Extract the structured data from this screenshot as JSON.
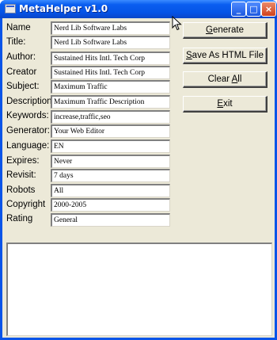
{
  "window": {
    "title": "MetaHelper v1.0"
  },
  "fields": [
    {
      "label": "Name",
      "value": "Nerd Lib Software Labs"
    },
    {
      "label": "Title:",
      "value": "Nerd Lib Software Labs"
    },
    {
      "label": "Author:",
      "value": "Sustained Hits Intl. Tech Corp"
    },
    {
      "label": "Creator",
      "value": "Sustained Hits Intl. Tech Corp"
    },
    {
      "label": "Subject:",
      "value": "Maximum Traffic"
    },
    {
      "label": "Description:",
      "value": "Maximum Traffic Description"
    },
    {
      "label": "Keywords:",
      "value": "increase,traffic,seo"
    },
    {
      "label": "Generator:",
      "value": "Your Web Editor"
    },
    {
      "label": "Language:",
      "value": "EN"
    },
    {
      "label": "Expires:",
      "value": "Never"
    },
    {
      "label": "Revisit:",
      "value": "7 days"
    },
    {
      "label": "Robots",
      "value": "All"
    },
    {
      "label": "Copyright",
      "value": "2000-2005"
    },
    {
      "label": "Rating",
      "value": "General"
    }
  ],
  "buttons": {
    "generate": {
      "pre": "",
      "key": "G",
      "post": "enerate"
    },
    "save": {
      "pre": "",
      "key": "S",
      "post": "ave As HTML File"
    },
    "clear": {
      "pre": "Clear ",
      "key": "A",
      "post": "ll"
    },
    "exit": {
      "pre": "",
      "key": "E",
      "post": "xit"
    }
  },
  "output": {
    "text": ""
  },
  "icons": {
    "minimize": "minimize-icon",
    "maximize": "maximize-icon",
    "close": "close-icon",
    "app": "app-icon"
  }
}
